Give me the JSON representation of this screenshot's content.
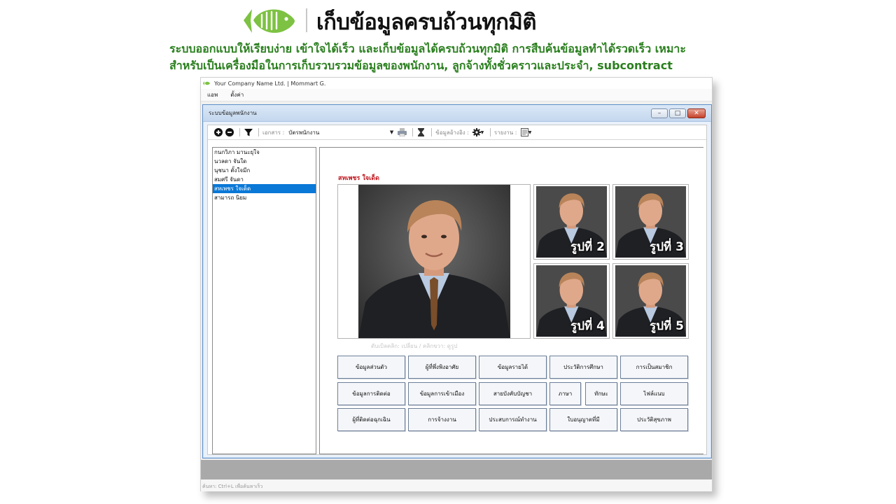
{
  "hero": {
    "title": "เก็บข้อมูลครบถ้วนทุกมิติ",
    "desc_line1": "ระบบออกแบบให้เรียบง่าย เข้าใจได้เร็ว และเก็บข้อมูลได้ครบถ้วนทุกมิติ การสืบค้นข้อมูลทำได้รวดเร็ว เหมาะ",
    "desc_line2": "สำหรับเป็นเครื่องมือในการเก็บรวบรวมข้อมูลของพนักงาน, ลูกจ้างทั้งชั่วคราวและประจำ, subcontract",
    "brand_color": "#7dc242"
  },
  "app": {
    "window_title": "Your Company Name Ltd. | Mommart G.",
    "menu": [
      "แอพ",
      "ตั้งค่า"
    ],
    "status_text": "ค้นหา: Ctrl+L เพื่อค้นหาเร็ว"
  },
  "inner_window": {
    "title": "ระบบข้อมูลพนักงาน",
    "controls": {
      "minimize": "–",
      "maximize": "□",
      "close": "✕"
    }
  },
  "toolbar": {
    "document_label": "เอกสาร :",
    "document_value": "บัตรพนักงาน",
    "reference_label": "ข้อมูลอ้างอิง :",
    "report_label": "รายงาน :"
  },
  "employees": [
    {
      "name": "กนกวิภา มานะยุใจ",
      "selected": false
    },
    {
      "name": "นวลดา จันใด",
      "selected": false
    },
    {
      "name": "นุชนา ตั้งใจมีก",
      "selected": false
    },
    {
      "name": "สมศรี จันดา",
      "selected": false
    },
    {
      "name": "สหเพชร ใจเด็ด",
      "selected": true
    },
    {
      "name": "สามารถ นิยม",
      "selected": false
    }
  ],
  "detail": {
    "employee_name": "สหเพชร ใจเด็ด",
    "photo_hint": "ดับเบิลคลิก: เปลี่ยน / คลิกขวา: ดูรูป",
    "thumbs": [
      "รูปที่ 2",
      "รูปที่ 3",
      "รูปที่ 4",
      "รูปที่ 5"
    ]
  },
  "buttons": {
    "personal": "ข้อมูลส่วนตัว",
    "dependents": "ผู้ที่พึ่งพิงอาศัย",
    "income": "ข้อมูลรายได้",
    "education": "ประวัติการศึกษา",
    "membership": "การเป็นสมาชิก",
    "contact": "ข้อมูลการติดต่อ",
    "entry": "ข้อมูลการเข้าเมือง",
    "chain": "สายบังคับบัญชา",
    "language": "ภาษา",
    "skill": "ทักษะ",
    "files": "ไฟล์แนบ",
    "emergency": "ผู้ที่ติดต่อฉุกเฉิน",
    "employment": "การจ้างงาน",
    "experience": "ประสบการณ์ทำงาน",
    "license": "ใบอนุญาตที่มี",
    "health": "ประวัติสุขภาพ"
  }
}
